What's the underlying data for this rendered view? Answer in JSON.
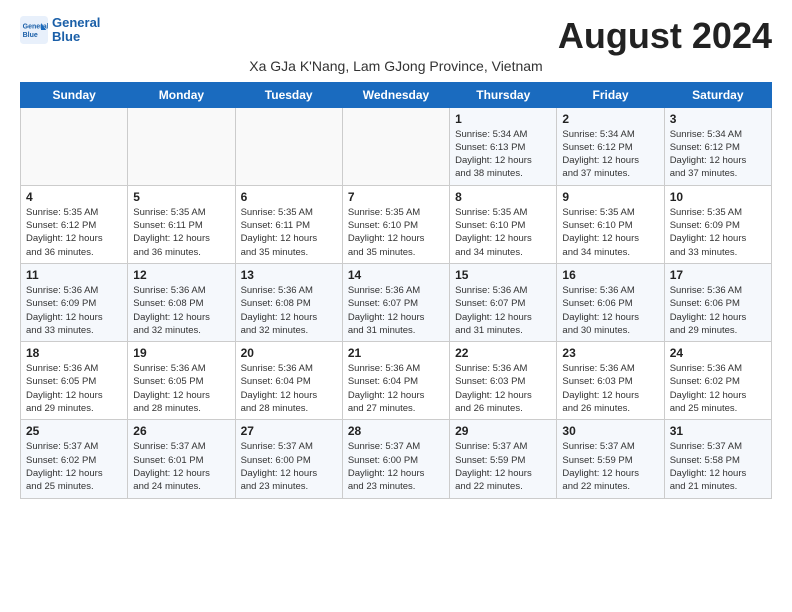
{
  "header": {
    "logo_line1": "General",
    "logo_line2": "Blue",
    "title": "August 2024",
    "subtitle": "Xa GJa K'Nang, Lam GJong Province, Vietnam"
  },
  "weekdays": [
    "Sunday",
    "Monday",
    "Tuesday",
    "Wednesday",
    "Thursday",
    "Friday",
    "Saturday"
  ],
  "weeks": [
    [
      {
        "day": "",
        "info": ""
      },
      {
        "day": "",
        "info": ""
      },
      {
        "day": "",
        "info": ""
      },
      {
        "day": "",
        "info": ""
      },
      {
        "day": "1",
        "info": "Sunrise: 5:34 AM\nSunset: 6:13 PM\nDaylight: 12 hours\nand 38 minutes."
      },
      {
        "day": "2",
        "info": "Sunrise: 5:34 AM\nSunset: 6:12 PM\nDaylight: 12 hours\nand 37 minutes."
      },
      {
        "day": "3",
        "info": "Sunrise: 5:34 AM\nSunset: 6:12 PM\nDaylight: 12 hours\nand 37 minutes."
      }
    ],
    [
      {
        "day": "4",
        "info": "Sunrise: 5:35 AM\nSunset: 6:12 PM\nDaylight: 12 hours\nand 36 minutes."
      },
      {
        "day": "5",
        "info": "Sunrise: 5:35 AM\nSunset: 6:11 PM\nDaylight: 12 hours\nand 36 minutes."
      },
      {
        "day": "6",
        "info": "Sunrise: 5:35 AM\nSunset: 6:11 PM\nDaylight: 12 hours\nand 35 minutes."
      },
      {
        "day": "7",
        "info": "Sunrise: 5:35 AM\nSunset: 6:10 PM\nDaylight: 12 hours\nand 35 minutes."
      },
      {
        "day": "8",
        "info": "Sunrise: 5:35 AM\nSunset: 6:10 PM\nDaylight: 12 hours\nand 34 minutes."
      },
      {
        "day": "9",
        "info": "Sunrise: 5:35 AM\nSunset: 6:10 PM\nDaylight: 12 hours\nand 34 minutes."
      },
      {
        "day": "10",
        "info": "Sunrise: 5:35 AM\nSunset: 6:09 PM\nDaylight: 12 hours\nand 33 minutes."
      }
    ],
    [
      {
        "day": "11",
        "info": "Sunrise: 5:36 AM\nSunset: 6:09 PM\nDaylight: 12 hours\nand 33 minutes."
      },
      {
        "day": "12",
        "info": "Sunrise: 5:36 AM\nSunset: 6:08 PM\nDaylight: 12 hours\nand 32 minutes."
      },
      {
        "day": "13",
        "info": "Sunrise: 5:36 AM\nSunset: 6:08 PM\nDaylight: 12 hours\nand 32 minutes."
      },
      {
        "day": "14",
        "info": "Sunrise: 5:36 AM\nSunset: 6:07 PM\nDaylight: 12 hours\nand 31 minutes."
      },
      {
        "day": "15",
        "info": "Sunrise: 5:36 AM\nSunset: 6:07 PM\nDaylight: 12 hours\nand 31 minutes."
      },
      {
        "day": "16",
        "info": "Sunrise: 5:36 AM\nSunset: 6:06 PM\nDaylight: 12 hours\nand 30 minutes."
      },
      {
        "day": "17",
        "info": "Sunrise: 5:36 AM\nSunset: 6:06 PM\nDaylight: 12 hours\nand 29 minutes."
      }
    ],
    [
      {
        "day": "18",
        "info": "Sunrise: 5:36 AM\nSunset: 6:05 PM\nDaylight: 12 hours\nand 29 minutes."
      },
      {
        "day": "19",
        "info": "Sunrise: 5:36 AM\nSunset: 6:05 PM\nDaylight: 12 hours\nand 28 minutes."
      },
      {
        "day": "20",
        "info": "Sunrise: 5:36 AM\nSunset: 6:04 PM\nDaylight: 12 hours\nand 28 minutes."
      },
      {
        "day": "21",
        "info": "Sunrise: 5:36 AM\nSunset: 6:04 PM\nDaylight: 12 hours\nand 27 minutes."
      },
      {
        "day": "22",
        "info": "Sunrise: 5:36 AM\nSunset: 6:03 PM\nDaylight: 12 hours\nand 26 minutes."
      },
      {
        "day": "23",
        "info": "Sunrise: 5:36 AM\nSunset: 6:03 PM\nDaylight: 12 hours\nand 26 minutes."
      },
      {
        "day": "24",
        "info": "Sunrise: 5:36 AM\nSunset: 6:02 PM\nDaylight: 12 hours\nand 25 minutes."
      }
    ],
    [
      {
        "day": "25",
        "info": "Sunrise: 5:37 AM\nSunset: 6:02 PM\nDaylight: 12 hours\nand 25 minutes."
      },
      {
        "day": "26",
        "info": "Sunrise: 5:37 AM\nSunset: 6:01 PM\nDaylight: 12 hours\nand 24 minutes."
      },
      {
        "day": "27",
        "info": "Sunrise: 5:37 AM\nSunset: 6:00 PM\nDaylight: 12 hours\nand 23 minutes."
      },
      {
        "day": "28",
        "info": "Sunrise: 5:37 AM\nSunset: 6:00 PM\nDaylight: 12 hours\nand 23 minutes."
      },
      {
        "day": "29",
        "info": "Sunrise: 5:37 AM\nSunset: 5:59 PM\nDaylight: 12 hours\nand 22 minutes."
      },
      {
        "day": "30",
        "info": "Sunrise: 5:37 AM\nSunset: 5:59 PM\nDaylight: 12 hours\nand 22 minutes."
      },
      {
        "day": "31",
        "info": "Sunrise: 5:37 AM\nSunset: 5:58 PM\nDaylight: 12 hours\nand 21 minutes."
      }
    ]
  ]
}
